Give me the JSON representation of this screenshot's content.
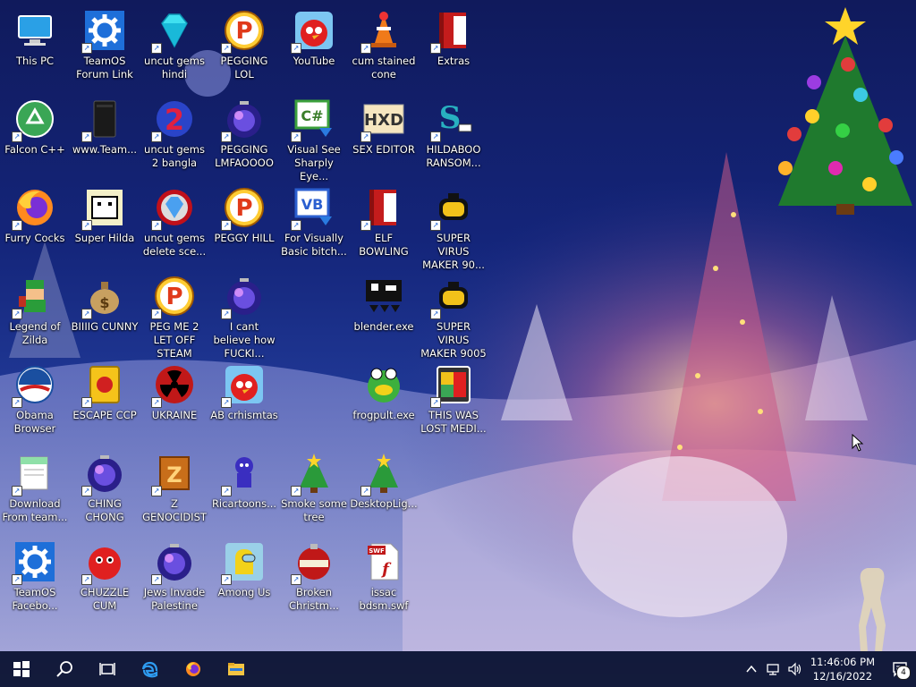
{
  "desktop": {
    "icons": [
      {
        "label": "This PC",
        "icon": "this-pc-icon",
        "shortcut": false
      },
      {
        "label": "TeamOS Forum Link",
        "icon": "gear-icon",
        "shortcut": true
      },
      {
        "label": "uncut gems hindi",
        "icon": "diamond-icon",
        "shortcut": true
      },
      {
        "label": "PEGGING LOL",
        "icon": "peggle-icon",
        "shortcut": true
      },
      {
        "label": "YouTube",
        "icon": "angry-bird-icon",
        "shortcut": true
      },
      {
        "label": "cum stained cone",
        "icon": "traffic-cone-icon",
        "shortcut": true
      },
      {
        "label": "Extras",
        "icon": "red-book-icon",
        "shortcut": true
      },
      {
        "label": "Falcon C++",
        "icon": "recycle-orb-icon",
        "shortcut": true
      },
      {
        "label": "www.Team...",
        "icon": "black-device-icon",
        "shortcut": true
      },
      {
        "label": "uncut gems 2 bangla",
        "icon": "number-two-icon",
        "shortcut": true
      },
      {
        "label": "PEGGING LMFAOOOO",
        "icon": "purple-ball-icon",
        "shortcut": true
      },
      {
        "label": "Visual See Sharply Eye...",
        "icon": "csharp-icon",
        "shortcut": true
      },
      {
        "label": "SEX EDITOR",
        "icon": "hxd-icon",
        "shortcut": true
      },
      {
        "label": "HILDABOO RANSOM...",
        "icon": "snake-s-icon",
        "shortcut": true
      },
      {
        "label": "Furry Cocks",
        "icon": "firefox-icon",
        "shortcut": true
      },
      {
        "label": "Super Hilda",
        "icon": "pixel-cat-icon",
        "shortcut": true
      },
      {
        "label": "uncut gems delete sce...",
        "icon": "gem-orb-icon",
        "shortcut": true
      },
      {
        "label": "PEGGY HILL",
        "icon": "peggle-icon",
        "shortcut": true
      },
      {
        "label": "For Visually Basic bitch...",
        "icon": "vb-icon",
        "shortcut": true
      },
      {
        "label": "ELF BOWLING",
        "icon": "red-book-icon",
        "shortcut": true
      },
      {
        "label": "SUPER VIRUS MAKER 90...",
        "icon": "yellow-bag-icon",
        "shortcut": true
      },
      {
        "label": "Legend of Zilda",
        "icon": "link-sprite-icon",
        "shortcut": true
      },
      {
        "label": "BIIIIG CUNNY",
        "icon": "money-bag-icon",
        "shortcut": true
      },
      {
        "label": "PEG ME 2 LET OFF STEAM",
        "icon": "peggle-icon",
        "shortcut": true
      },
      {
        "label": "I cant believe how FUCKI...",
        "icon": "purple-ball-icon",
        "shortcut": true
      },
      {
        "label": "blender.exe",
        "icon": "blender-icon",
        "shortcut": false
      },
      {
        "label": "SUPER VIRUS MAKER 9005",
        "icon": "yellow-bag-icon",
        "shortcut": true
      },
      {
        "label": "Obama Browser",
        "icon": "obama-logo-icon",
        "shortcut": true
      },
      {
        "label": "ESCAPE CCP",
        "icon": "mahjong-tile-icon",
        "shortcut": true
      },
      {
        "label": "UKRAINE",
        "icon": "radiation-icon",
        "shortcut": true
      },
      {
        "label": "AB crhismtas",
        "icon": "angry-bird-icon",
        "shortcut": true
      },
      {
        "label": "frogpult.exe",
        "icon": "frog-icon",
        "shortcut": false
      },
      {
        "label": "THIS WAS LOST MEDI...",
        "icon": "media-box-icon",
        "shortcut": true
      },
      {
        "label": "Download From team...",
        "icon": "notepad-icon",
        "shortcut": true
      },
      {
        "label": "CHING CHONG",
        "icon": "purple-ball-icon",
        "shortcut": true
      },
      {
        "label": "Z GENOCIDIST",
        "icon": "z-block-icon",
        "shortcut": true
      },
      {
        "label": "Ricartoons...",
        "icon": "cartoon-character-icon",
        "shortcut": true
      },
      {
        "label": "Smoke some tree",
        "icon": "christmas-tree-icon",
        "shortcut": true
      },
      {
        "label": "DesktopLig...",
        "icon": "christmas-tree-icon",
        "shortcut": true
      },
      {
        "label": "TeamOS Facebo...",
        "icon": "gear-icon",
        "shortcut": true
      },
      {
        "label": "CHUZZLE CUM",
        "icon": "chuzzle-icon",
        "shortcut": true
      },
      {
        "label": "Jews Invade Palestine",
        "icon": "purple-ball-icon",
        "shortcut": true
      },
      {
        "label": "Among Us",
        "icon": "among-us-icon",
        "shortcut": true
      },
      {
        "label": "Broken Christm...",
        "icon": "ornament-icon",
        "shortcut": true
      },
      {
        "label": "issac bdsm.swf",
        "icon": "swf-file-icon",
        "shortcut": false
      }
    ]
  },
  "taskbar": {
    "start": "windows-logo-icon",
    "search": "search-icon",
    "task_view": "task-view-icon",
    "pinned": [
      "edge-icon",
      "firefox-icon",
      "file-explorer-icon"
    ],
    "tray": {
      "chevron": "chevron-up-icon",
      "network": "network-icon",
      "volume": "volume-icon"
    },
    "time": "11:46:06 PM",
    "date": "12/16/2022",
    "notification_count": "4"
  }
}
